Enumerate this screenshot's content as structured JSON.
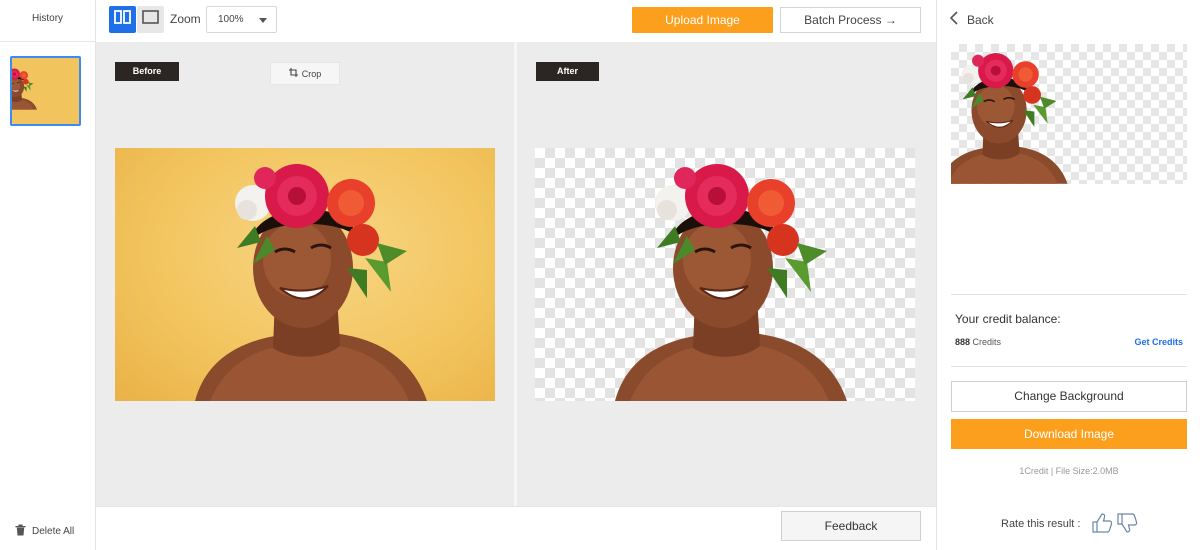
{
  "history": {
    "title": "History",
    "delete_all_label": "Delete All"
  },
  "toolbar": {
    "zoom_label": "Zoom",
    "zoom_value": "100%",
    "upload_label": "Upload Image",
    "batch_label": "Batch Process →"
  },
  "compare": {
    "before_label": "Before",
    "after_label": "After",
    "crop_label": "Crop"
  },
  "footer": {
    "feedback_label": "Feedback"
  },
  "right_panel": {
    "back_label": "Back",
    "credit_label": "Your credit balance:",
    "credit_number": "888",
    "credit_unit": "Credits",
    "get_credits_label": "Get Credits",
    "change_background_label": "Change Background",
    "download_label": "Download Image",
    "file_info": "1Credit | File Size:2.0MB",
    "rate_label": "Rate this result :"
  },
  "colors": {
    "accent_orange": "#fb9f1d",
    "accent_blue": "#1e6fe8",
    "tag_dark": "#2b2523",
    "background_yellow": "#f2c45d"
  },
  "icons": {
    "view_split": "split-view-icon",
    "view_single": "single-view-icon",
    "crop": "crop-icon",
    "delete": "trash-icon",
    "back": "chevron-left-icon",
    "thumb_up": "thumbs-up-icon",
    "thumb_down": "thumbs-down-icon"
  }
}
